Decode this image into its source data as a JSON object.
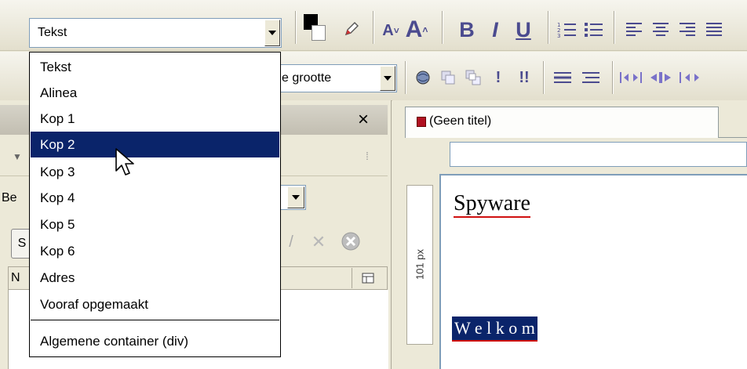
{
  "toolbar": {
    "format_select": {
      "value": "Tekst"
    },
    "size_select": {
      "value": "e grootte"
    },
    "bold": "B",
    "italic": "I",
    "underline": "U",
    "font_larger": "A",
    "font_smaller": "A",
    "exclaim1": "!",
    "exclaim2": "!!"
  },
  "format_menu": {
    "items": [
      {
        "label": "Tekst"
      },
      {
        "label": "Alinea"
      },
      {
        "label": "Kop 1"
      },
      {
        "label": "Kop 2"
      },
      {
        "label": "Kop 3"
      },
      {
        "label": "Kop 4"
      },
      {
        "label": "Kop 5"
      },
      {
        "label": "Kop 6"
      },
      {
        "label": "Adres"
      },
      {
        "label": "Vooraf opgemaakt"
      },
      {
        "label": "Algemene container (div)"
      }
    ],
    "selected_index": 3
  },
  "left_panel": {
    "close": "×",
    "row_label": "Be",
    "button_label": "S",
    "column_header": "N"
  },
  "document": {
    "tab_title": "(Geen titel)",
    "ruler_label": "101 px",
    "heading": "Spyware",
    "selected_text": "W e l k o m"
  },
  "colors": {
    "selection": "#0a246a",
    "toolbar_icon": "#4b4b8f",
    "spellcheck": "#d01010"
  }
}
